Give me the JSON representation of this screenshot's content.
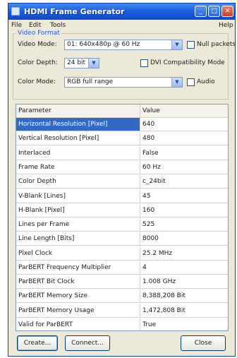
{
  "window": {
    "title": "HDMI Frame Generator"
  },
  "titlebar": {
    "minimize": "_",
    "maximize": "□",
    "close": "✕"
  },
  "menu": {
    "file": "File",
    "edit": "Edit",
    "tools": "Tools",
    "help": "Help"
  },
  "video_format": {
    "legend": "Video Format",
    "video_mode_label": "Video Mode:",
    "video_mode_value": "01: 640x480p @ 60 Hz",
    "color_depth_label": "Color Depth:",
    "color_depth_value": "24 bit",
    "color_mode_label": "Color Mode:",
    "color_mode_value": "RGB full range",
    "null_packets_label": "Null packets",
    "dvi_label": "DVI Compatibility Mode",
    "audio_label": "Audio",
    "dropdown_glyph": "▼"
  },
  "table": {
    "headers": {
      "param": "Parameter",
      "value": "Value"
    },
    "rows": [
      {
        "param": "Horizontal Resolution [Pixel]",
        "value": "640"
      },
      {
        "param": "Vertical Resolution [Pixel]",
        "value": "480"
      },
      {
        "param": "Interlaced",
        "value": "False"
      },
      {
        "param": "Frame Rate",
        "value": "60 Hz"
      },
      {
        "param": "Color Depth",
        "value": "c_24bit"
      },
      {
        "param": "V-Blank [Lines]",
        "value": "45"
      },
      {
        "param": "H-Blank [Pixel]",
        "value": "160"
      },
      {
        "param": "Lines per Frame",
        "value": "525"
      },
      {
        "param": "Line Length [Bits]",
        "value": "8000"
      },
      {
        "param": "Pixel Clock",
        "value": "25.2 MHz"
      },
      {
        "param": "ParBERT Frequency Multiplier",
        "value": "4"
      },
      {
        "param": "ParBERT Bit Clock",
        "value": "1.008 GHz"
      },
      {
        "param": "ParBERT Memory Size",
        "value": "8,388,208 Bit"
      },
      {
        "param": "ParBERT Memory Usage",
        "value": "1,472,808 Bit"
      },
      {
        "param": "Valid for ParBERT",
        "value": "True"
      }
    ]
  },
  "buttons": {
    "create": "Create...",
    "connect": "Connect...",
    "close": "Close"
  },
  "colors": {
    "selection": "#316ac5",
    "titlebar": "#1c5fe0",
    "window_bg": "#ece9d8"
  }
}
